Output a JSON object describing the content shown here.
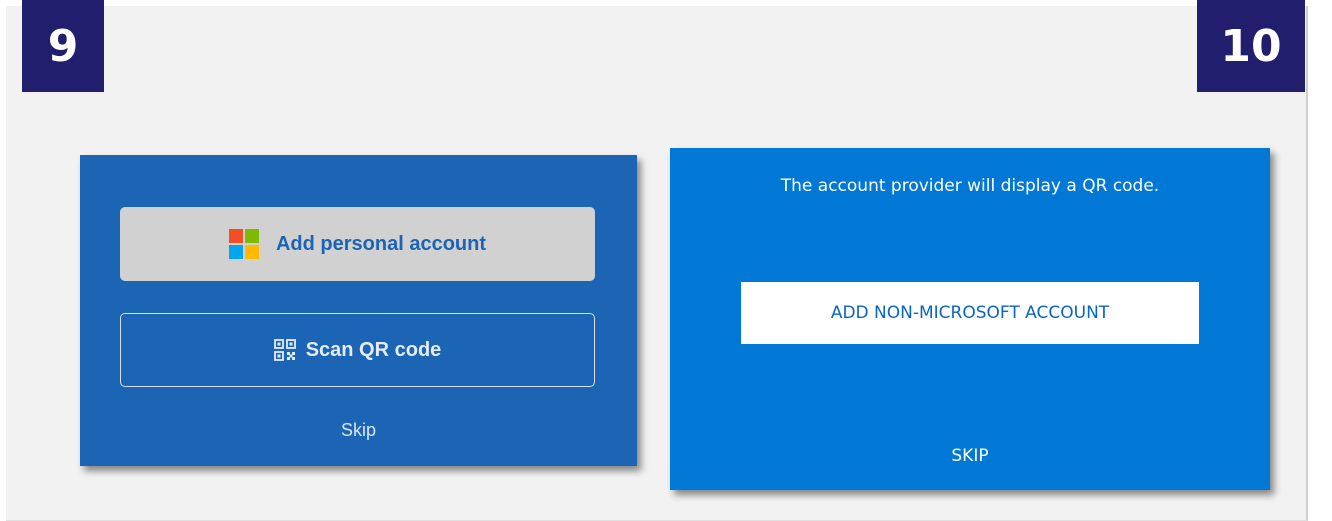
{
  "steps": {
    "left": "9",
    "right": "10"
  },
  "screen_9": {
    "personal_button_label": "Add personal account",
    "personal_button_icon": "microsoft-logo-icon",
    "scan_button_label": "Scan QR code",
    "scan_button_icon": "qr-code-icon",
    "skip_label": "Skip",
    "background_color": "#1b65b4"
  },
  "screen_10": {
    "info_text": "The account provider will display a QR code.",
    "add_button_label": "ADD NON-MICROSOFT ACCOUNT",
    "skip_label": "SKIP",
    "background_color": "#0178d5"
  },
  "colors": {
    "badge": "#221e6e",
    "ms_red": "#f25022",
    "ms_green": "#7fba00",
    "ms_blue": "#00a4ef",
    "ms_yellow": "#ffb900"
  }
}
